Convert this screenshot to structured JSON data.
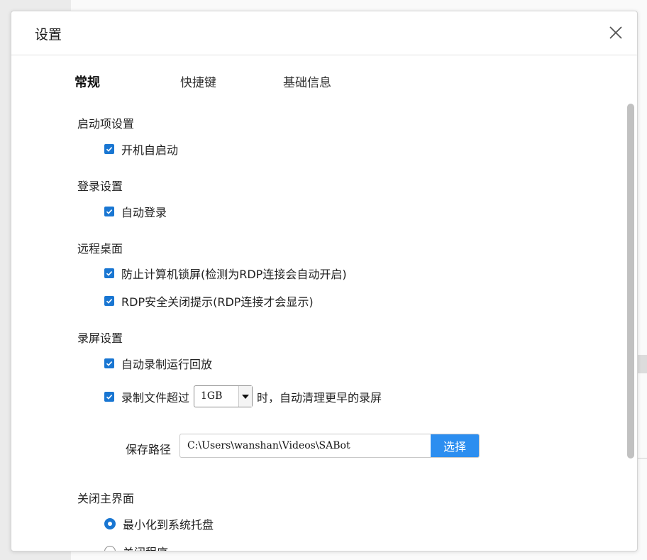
{
  "dialog": {
    "title": "设置",
    "close_icon": "close-icon"
  },
  "tabs": [
    {
      "label": "常规",
      "active": true
    },
    {
      "label": "快捷键",
      "active": false
    },
    {
      "label": "基础信息",
      "active": false
    }
  ],
  "sections": {
    "startup": {
      "title": "启动项设置",
      "options": [
        {
          "label": "开机自启动",
          "checked": true
        }
      ]
    },
    "login": {
      "title": "登录设置",
      "options": [
        {
          "label": "自动登录",
          "checked": true
        }
      ]
    },
    "remote": {
      "title": "远程桌面",
      "options": [
        {
          "label": "防止计算机锁屏(检测为RDP连接会自动开启)",
          "checked": true
        },
        {
          "label": "RDP安全关闭提示(RDP连接才会显示)",
          "checked": true
        }
      ]
    },
    "recording": {
      "title": "录屏设置",
      "options": [
        {
          "label": "自动录制运行回放",
          "checked": true
        }
      ],
      "limit": {
        "checked": true,
        "prefix": "录制文件超过",
        "selected": "1GB",
        "suffix": "时，自动清理更早的录屏"
      },
      "path": {
        "label": "保存路径",
        "value": "C:\\Users\\wanshan\\Videos\\SABot",
        "button": "选择"
      }
    },
    "close_main": {
      "title": "关闭主界面",
      "options": [
        {
          "label": "最小化到系统托盘",
          "checked": true
        },
        {
          "label": "关闭程序",
          "checked": false
        }
      ]
    }
  },
  "colors": {
    "accent": "#1976d2",
    "button": "#2c8ef0"
  }
}
